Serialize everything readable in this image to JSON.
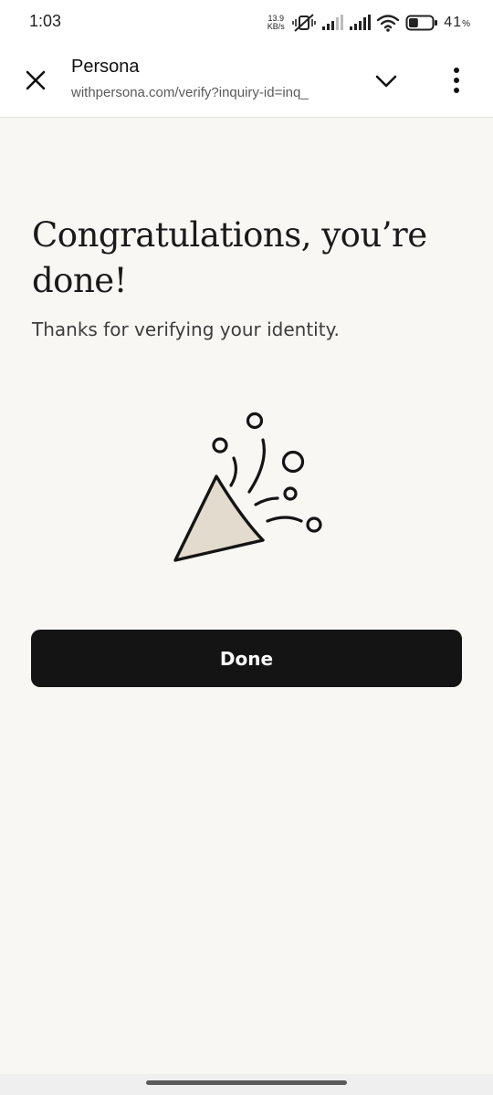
{
  "status_bar": {
    "time": "1:03",
    "net_speed_value": "13.9",
    "net_speed_unit": "KB/s",
    "battery_percent": "41",
    "battery_percent_sign": "%",
    "battery_level": 0.41,
    "icons": [
      "mute-vibrate-icon",
      "signal-icon",
      "signal-icon",
      "wifi-icon",
      "battery-icon"
    ]
  },
  "browser": {
    "title": "Persona",
    "url": "withpersona.com/verify?inquiry-id=inq_",
    "icons": {
      "close": "close-icon",
      "expand": "chevron-down-icon",
      "menu": "more-vertical-icon"
    }
  },
  "main": {
    "heading": "Congratulations, you’re done!",
    "subtitle": "Thanks for verifying your identity.",
    "illustration": "party-popper-icon",
    "done_label": "Done"
  },
  "colors": {
    "background": "#f8f7f4",
    "button": "#141414",
    "button_text": "#ffffff",
    "popper_fill": "#e3dbcd"
  }
}
